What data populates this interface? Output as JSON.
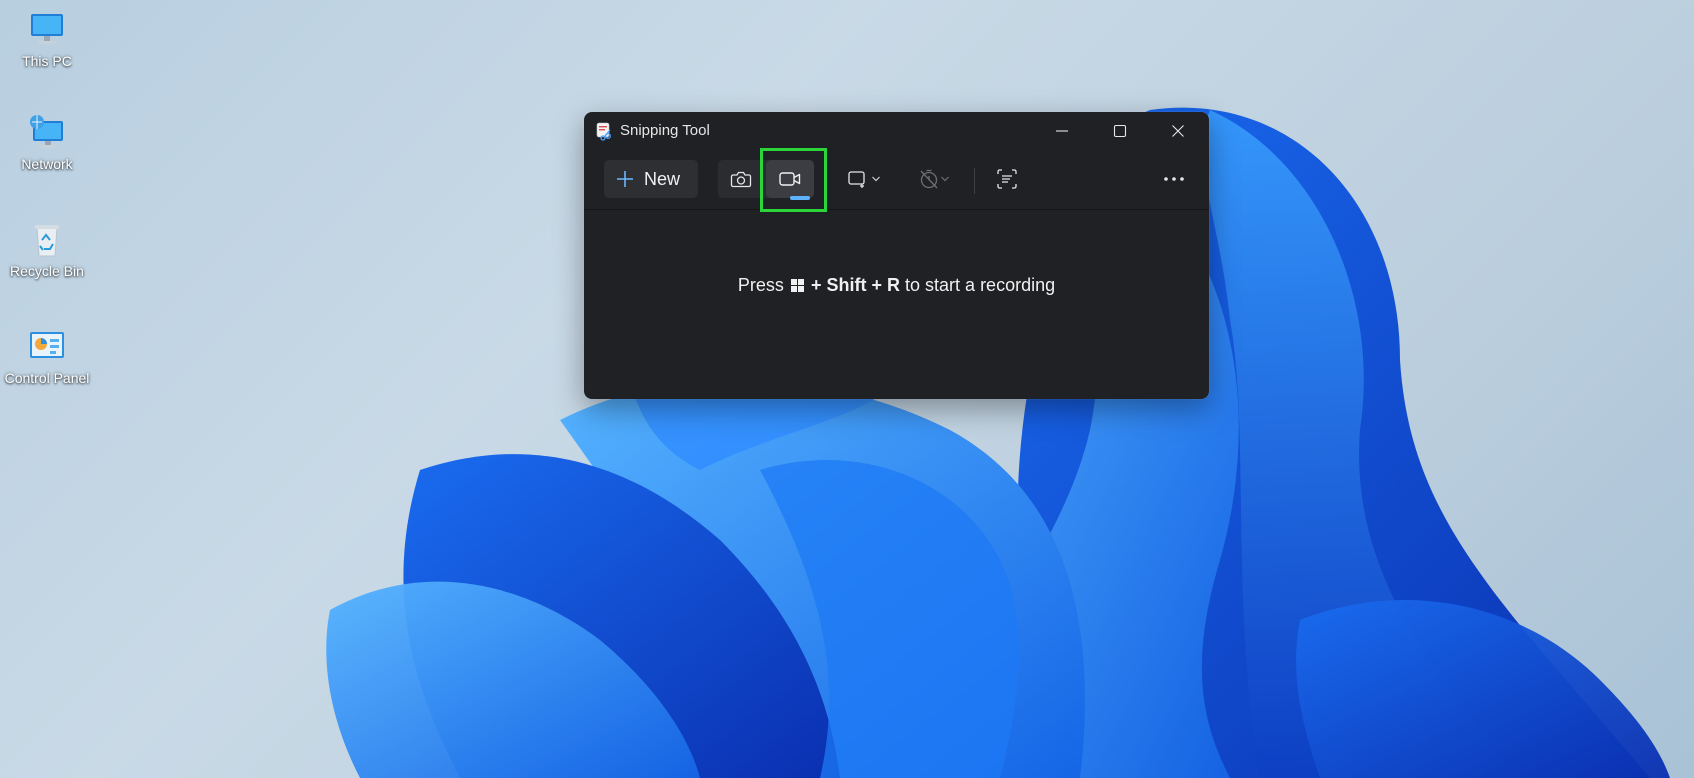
{
  "desktop": {
    "icons": [
      {
        "label": "This PC"
      },
      {
        "label": "Network"
      },
      {
        "label": "Recycle Bin"
      },
      {
        "label": "Control Panel"
      }
    ]
  },
  "window": {
    "title": "Snipping Tool",
    "toolbar": {
      "new_label": "New",
      "selected_mode": "video",
      "icons": [
        "camera-icon",
        "video-icon",
        "rectangle-mode-icon",
        "timer-icon",
        "text-actions-icon",
        "more-icon"
      ]
    },
    "hint": {
      "prefix": "Press",
      "plus1": "+",
      "key1": "Shift",
      "plus2": "+",
      "key2": "R",
      "suffix": "to start a recording"
    }
  },
  "colors": {
    "accent": "#5eb3ff",
    "highlight": "#2bd63a",
    "window_bg": "#202124"
  }
}
